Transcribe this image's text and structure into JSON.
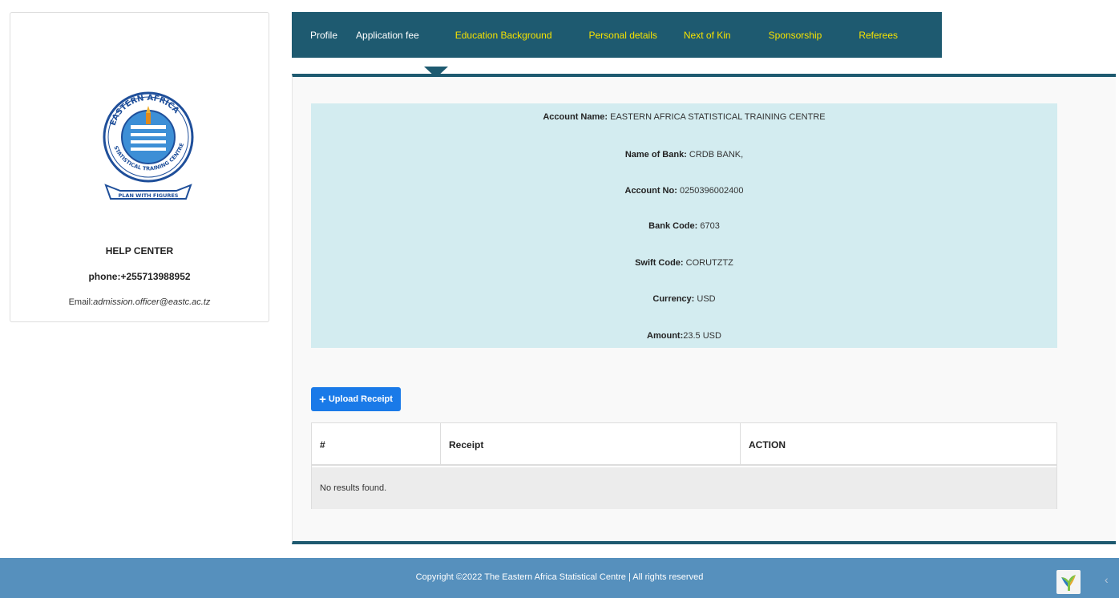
{
  "help": {
    "logo_top_text": "EASTERN AFRICA",
    "logo_ring_text": "STATISTICAL TRAINING CENTRE",
    "logo_banner": "PLAN WITH FIGURES",
    "title": "HELP CENTER",
    "phone": "phone:+255713988952",
    "email_label": "Email:",
    "email_value": "admission.officer@eastc.ac.tz"
  },
  "tabs": [
    {
      "label": "Profile"
    },
    {
      "label": "Application fee"
    },
    {
      "label": "Education Background"
    },
    {
      "label": "Personal details"
    },
    {
      "label": "Next of Kin"
    },
    {
      "label": "Sponsorship"
    },
    {
      "label": "Referees"
    }
  ],
  "bank": {
    "account_name_label": "Account Name:",
    "account_name_value": " EASTERN AFRICA STATISTICAL TRAINING CENTRE",
    "bank_name_label": "Name of Bank:",
    "bank_name_value": " CRDB BANK,",
    "account_no_label": "Account No:",
    "account_no_value": " 0250396002400",
    "bank_code_label": "Bank Code:",
    "bank_code_value": " 6703",
    "swift_label": "Swift Code:",
    "swift_value": " CORUTZTZ",
    "currency_label": "Currency:",
    "currency_value": " USD",
    "amount_label": "Amount:",
    "amount_value": "23.5 USD"
  },
  "upload_button": "Upload Receipt",
  "table": {
    "columns": [
      "#",
      "Receipt",
      "ACTION"
    ],
    "empty_text": "No results found."
  },
  "footer": {
    "copyright": "Copyright ©2022 The Eastern Africa Statistical Centre | All rights reserved"
  },
  "colors": {
    "nav_bg": "#1e5a70",
    "nav_active_text": "#ffffff",
    "nav_inactive_text": "#f6e200",
    "bank_box_bg": "#d3ecf0",
    "button_primary": "#1a7ae8",
    "footer_bg": "#5690bd"
  },
  "icons": {
    "upload": "plus-icon",
    "debug_badge": "yii-logo-icon",
    "collapse": "chevron-left-icon"
  }
}
